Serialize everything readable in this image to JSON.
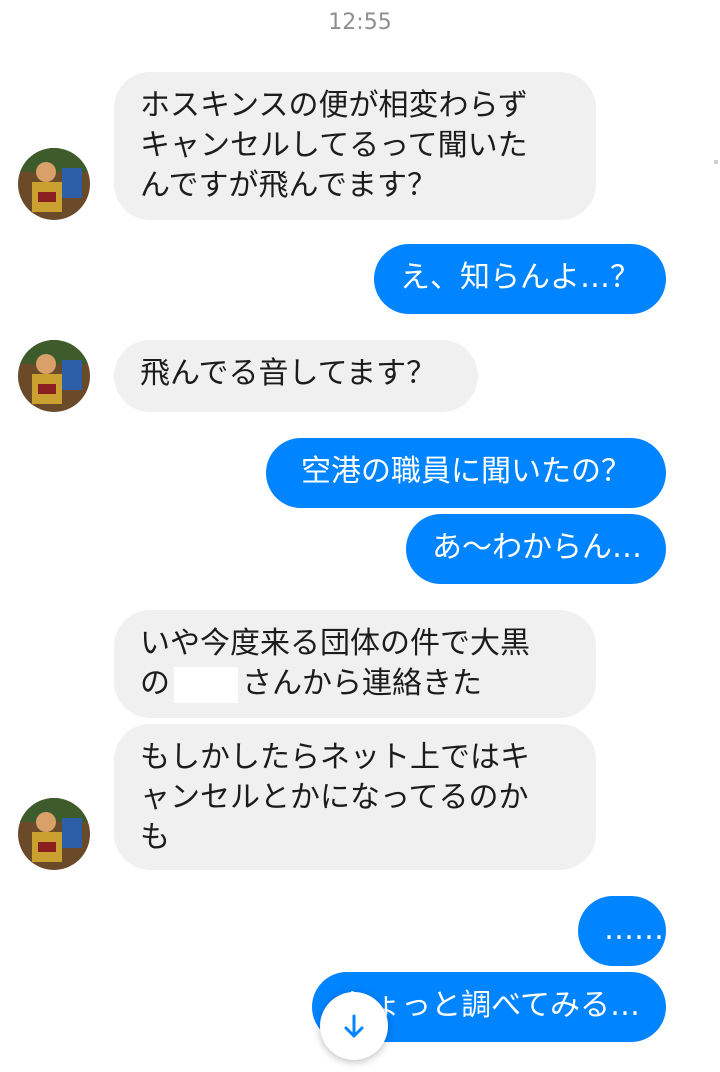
{
  "timestamp": "12:55",
  "messages": [
    {
      "dir": "in",
      "lines": [
        "ホスキンスの便が相変わらず",
        "キャンセルしてるって聞いた",
        "んですが飛んでます？"
      ]
    },
    {
      "dir": "out",
      "text": "え、知らんよ…？"
    },
    {
      "dir": "in",
      "text": "飛んでる音してます？"
    },
    {
      "dir": "out",
      "text": "空港の職員に聞いたの？"
    },
    {
      "dir": "out",
      "text": "あ〜わからん…"
    },
    {
      "dir": "in",
      "lines": [
        "いや今度来る団体の件で大黒",
        "の",
        "さんから連絡きた"
      ]
    },
    {
      "dir": "in",
      "lines": [
        "もしかしたらネット上ではキ",
        "ャンセルとかになってるのか",
        "も"
      ]
    },
    {
      "dir": "out",
      "text": "……"
    },
    {
      "dir": "out",
      "text": "ちょっと調べてみる…"
    }
  ],
  "icons": {
    "avatar": "contact-avatar",
    "scroll": "arrow-down-icon"
  },
  "colors": {
    "outgoing_bubble": "#0084ff",
    "incoming_bubble": "#f0f0f0",
    "scroll_arrow": "#0084ff"
  }
}
